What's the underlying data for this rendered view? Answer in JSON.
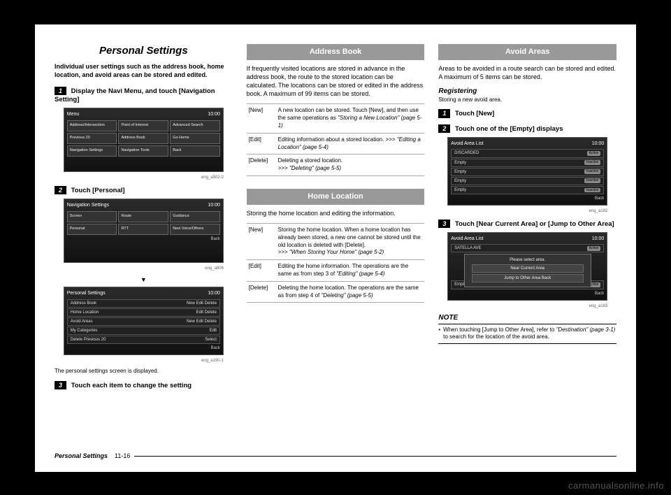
{
  "page": {
    "title": "Personal Settings",
    "intro": "Individual user settings such as the address book, home location, and avoid areas can be stored and edited.",
    "footer_title": "Personal Settings",
    "footer_page": "11-16"
  },
  "col1": {
    "step1": "Display the Navi Menu, and touch [Navigation Setting]",
    "shot1": {
      "title": "Menu",
      "time": "10:00",
      "items": [
        "Address/Intersection",
        "Point of Interest",
        "Advanced Search",
        "Previous 20",
        "Address Book",
        "Go Home",
        "Navigation Settings",
        "Navigation Tools",
        "Back"
      ],
      "caption": "eng_a502-2"
    },
    "step2": "Touch [Personal]",
    "shot2": {
      "title": "Navigation Settings",
      "time": "10:00",
      "items": [
        "Screen",
        "Route",
        "Guidance",
        "Personal",
        "RTT",
        "Navi Voice/Others"
      ],
      "back": "Back",
      "caption": "eng_a606"
    },
    "arrow": "▼",
    "shot3": {
      "title": "Personal Settings",
      "time": "10:00",
      "rows": [
        [
          "Address Book",
          "New",
          "Edit",
          "Delete"
        ],
        [
          "Home Location",
          "",
          "Edit",
          "Delete"
        ],
        [
          "Avoid Areas",
          "New",
          "Edit",
          "Delete"
        ],
        [
          "My Categories",
          "",
          "",
          "Edit"
        ],
        [
          "Delete Previous 20",
          "",
          "",
          "Select"
        ]
      ],
      "back": "Back",
      "caption": "eng_a190-1"
    },
    "shot3_note": "The personal settings screen is displayed.",
    "step3": "Touch each item to change the setting"
  },
  "col2": {
    "sec1_title": "Address Book",
    "sec1_body": "If frequently visited locations are stored in advance in the address book, the route to the stored location can be calculated. The locations can be stored or edited in the address book. A maximum of 99 items can be stored.",
    "sec1_table": [
      {
        "k": "[New]",
        "v": "A new location can be stored. Touch [New], and then use the same operations as ",
        "ref": "\"Storing a New Location\" (page 5-1)"
      },
      {
        "k": "[Edit]",
        "v": "Editing information about a stored location. ",
        "pre": ">>> ",
        "ref": "\"Editing a Location\" (page 5-4)"
      },
      {
        "k": "[Delete]",
        "v": "Deleting a stored location.",
        "pre": ">>> ",
        "ref": "\"Deleting\" (page 5-5)"
      }
    ],
    "sec2_title": "Home Location",
    "sec2_body": "Storing the home location and editing the information.",
    "sec2_table": [
      {
        "k": "[New]",
        "v": "Storing the home location. When a home location has already been stored, a new one cannot be stored until the old location is deleted with [Delete].",
        "pre": ">>> ",
        "ref": "\"When Storing Your Home\" (page 5-2)"
      },
      {
        "k": "[Edit]",
        "v": "Editing the home information. The operations are the same as from step 3 of ",
        "ref": "\"Editing\" (page 5-4)"
      },
      {
        "k": "[Delete]",
        "v": "Deleting the home location. The operations are the same as from step 4 of ",
        "ref": "\"Deleting\" (page 5-5)"
      }
    ]
  },
  "col3": {
    "sec_title": "Avoid Areas",
    "sec_body": "Areas to be avoided in a route search can be stored and edited. A maximum of 5 items can be stored.",
    "reg_head": "Registering",
    "reg_sub": "Storing a new avoid area.",
    "step1": "Touch [New]",
    "step2": "Touch one of the [Empty] displays",
    "shot1": {
      "title": "Avoid Area List",
      "time": "10:00",
      "rows": [
        [
          "DISCARDED",
          "Active"
        ],
        [
          "Empty",
          "Inactive"
        ],
        [
          "Empty",
          "Inactive"
        ],
        [
          "Empty",
          "Inactive"
        ],
        [
          "Empty",
          "Inactive"
        ]
      ],
      "back": "Back",
      "caption": "eng_a182"
    },
    "step3": "Touch [Near Current Area] or [Jump to Other Area]",
    "shot2": {
      "title": "Avoid Area List",
      "time": "10:00",
      "popup_head": "Please select area.",
      "popup_opts": [
        "Near Current Area",
        "Jump to Other Area     Back"
      ],
      "row_top": [
        "SATELLA AVE",
        "Active"
      ],
      "row_bot": [
        "Empty",
        "Inactive"
      ],
      "back": "Back",
      "caption": "eng_a183"
    },
    "note_head": "NOTE",
    "note_body_a": "When touching [Jump to Other Area], refer to ",
    "note_body_ref": "\"Destination\" (page 3-1)",
    "note_body_b": " to search for the location of the avoid area."
  },
  "watermark": "carmanualsonline.info"
}
